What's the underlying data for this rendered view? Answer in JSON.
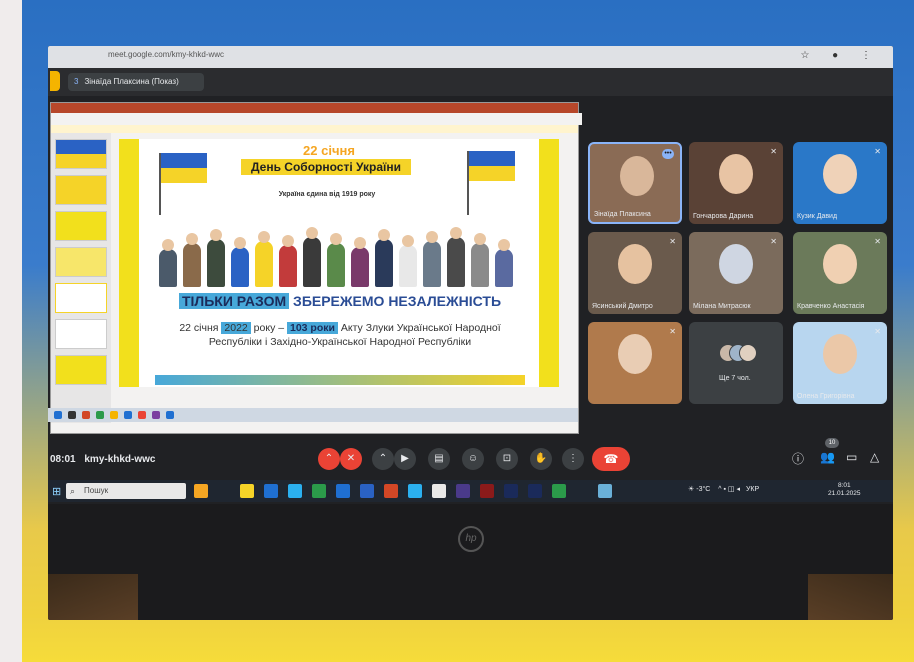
{
  "browser": {
    "url": "meet.google.com/kmy-khkd-wwc"
  },
  "meet": {
    "presenter_number": "3",
    "presenter_label": "Зінаїда Плаксина (Показ)",
    "time": "08:01",
    "meeting_code": "kmy-khkd-wwc",
    "participant_count": "10"
  },
  "slide": {
    "date": "22 січня",
    "heading": "День Соборності України",
    "subheading": "Україна єдина від 1919 року",
    "main_highlight": "ТІЛЬКИ РАЗОМ",
    "main_rest": " ЗБЕРЕЖЕМО НЕЗАЛЕЖНІСТЬ",
    "body_prefix": "22 січня",
    "body_year": "2022",
    "body_middle": "року –",
    "body_years": "103 роки",
    "body_suffix": "Акту Злуки Української Народної Республіки і Західно-Української Народної Республіки"
  },
  "participants": [
    {
      "name": "Зінаїда Плаксина",
      "active": true,
      "skin": "#d9b79a",
      "bg": "#8a6b55"
    },
    {
      "name": "Гончарова Дарина",
      "active": false,
      "skin": "#e8c4a4",
      "bg": "#5a4236"
    },
    {
      "name": "Кузик Давид",
      "active": false,
      "skin": "#efd2b8",
      "bg": "#2a78c8"
    },
    {
      "name": "Ясинський Дмитро",
      "active": false,
      "skin": "#e6c2a0",
      "bg": "#6a5a4c"
    },
    {
      "name": "Мілана Митрасюк",
      "active": false,
      "skin": "#cfd6e2",
      "bg": "#7b6b5c"
    },
    {
      "name": "Кравченко Анастасія",
      "active": false,
      "skin": "#f0d0b2",
      "bg": "#6b7a5a"
    },
    {
      "name": "",
      "active": false,
      "skin": "#e9cdb4",
      "bg": "#b07a4c"
    },
    {
      "name": "Ще 7 чол.",
      "active": false,
      "skin": "",
      "bg": "#3c4043"
    },
    {
      "name": "Олена Григорівна",
      "active": false,
      "skin": "#ebc8a8",
      "bg": "#b8d6ef"
    }
  ],
  "taskbar": {
    "search_placeholder": "Пошук",
    "temperature": "-3°C",
    "language": "УКР",
    "tray_time": "8:01",
    "tray_date": "21.01.2025"
  },
  "bezel_logo": "hp",
  "colors": {
    "ukraine_blue": "#2a62c4",
    "ukraine_yellow": "#f5d328",
    "meet_dark": "#202124",
    "hangup_red": "#ea4335"
  }
}
